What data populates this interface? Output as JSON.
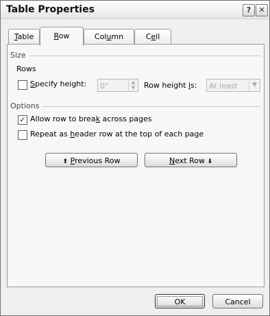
{
  "window": {
    "title": "Table Properties",
    "help_glyph": "?",
    "close_glyph": "✕"
  },
  "tabs": [
    {
      "pre": "",
      "key": "T",
      "post": "able"
    },
    {
      "pre": "",
      "key": "R",
      "post": "ow"
    },
    {
      "pre": "Col",
      "key": "u",
      "post": "mn"
    },
    {
      "pre": "C",
      "key": "e",
      "post": "ll"
    }
  ],
  "size": {
    "section_label": "Size",
    "rows_label": "Rows",
    "specify_height": {
      "pre": "",
      "key": "S",
      "post": "pecify height:",
      "checked": false
    },
    "height_value": "0\"",
    "row_height_is": {
      "pre": "Row height ",
      "key": "i",
      "post": "s:"
    },
    "row_height_mode": "At least"
  },
  "options": {
    "section_label": "Options",
    "allow_break": {
      "pre": "Allow row to brea",
      "key": "k",
      "post": " across pages",
      "checked": true
    },
    "repeat_header": {
      "pre": "Repeat as ",
      "key": "h",
      "post": "eader row at the top of each page",
      "checked": false
    }
  },
  "nav": {
    "previous": {
      "arrow": "⬆",
      "pre": "",
      "key": "P",
      "post": "revious Row"
    },
    "next": {
      "pre": "",
      "key": "N",
      "post": "ext Row",
      "arrow": "⬇"
    }
  },
  "footer": {
    "ok_label": "OK",
    "cancel_label": "Cancel"
  },
  "icons": {
    "spinner_up": "▲",
    "spinner_down": "▼",
    "dropdown": "▼",
    "checkmark": "✓"
  }
}
